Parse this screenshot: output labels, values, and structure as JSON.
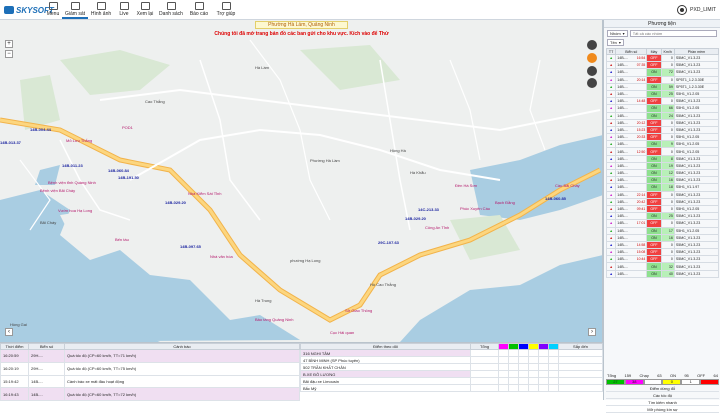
{
  "app": {
    "logo_text": "SKYSOFT",
    "user": "PXD_LIMIT"
  },
  "nav": [
    {
      "label": "Menu",
      "icon": "menu-icon"
    },
    {
      "label": "Giám sát",
      "icon": "monitor-icon"
    },
    {
      "label": "Hình ảnh",
      "icon": "image-icon"
    },
    {
      "label": "Live",
      "icon": "live-icon"
    },
    {
      "label": "Xem lại",
      "icon": "replay-icon"
    },
    {
      "label": "Danh sách",
      "icon": "list-icon"
    },
    {
      "label": "Báo cáo",
      "icon": "report-icon"
    },
    {
      "label": "Trợ giúp",
      "icon": "help-icon"
    }
  ],
  "map": {
    "location": "Phường Hà Lầm, Quảng Ninh",
    "notice": "Chúng tôi đã mở trang bản đồ các ban gửi cho khu vực. Kích vào để Thử",
    "labels": [
      "Hà Lầm",
      "Cao Thắng",
      "Phường Hà Lầm",
      "Hà Khẩu",
      "Bãi Cháy",
      "Hồng Gai",
      "phường Hạ Long",
      "Hồng Hà",
      "Hà Trung",
      "Hồ Cao Thắng"
    ],
    "plates": [
      "14B-004.44",
      "14B-013.37",
      "14B-011.23",
      "14B-060.84",
      "14B-191.50",
      "14B-029.20",
      "14B-097.65",
      "29C-107.63",
      "14C-213.33",
      "14B-029.20",
      "14B-060.85"
    ],
    "pois": [
      "POD1",
      "Mỏ Lưu Thắng",
      "Vườn hoa Hạ Long",
      "Bệnh viện Bãi Cháy",
      "Nhà Kiểm Sát Tỉnh",
      "Bệnh viện tỉnh Quảng Ninh",
      "Nhà văn hóa",
      "Công An Tỉnh",
      "Cầu Bãi Cháy",
      "Bảo tàng Quảng Ninh",
      "Bến tàu",
      "Phúc Xuyên Cầu",
      "Bạch Đằng",
      "Cục Hải quan",
      "Đền Hà Sơn",
      "Sở Giao Thông"
    ]
  },
  "panel": {
    "title": "Phương tiện",
    "group_select": "Nhóm",
    "search_placeholder": "Tất cả các nhóm",
    "sort_select": "Tên",
    "columns": [
      "TT",
      "Biển số",
      "Máy",
      "Km/h",
      "Phần mềm"
    ],
    "vehicles": [
      {
        "plate": "14B-...",
        "time": "16:54",
        "state": "OFF",
        "speed": "0",
        "sw": "S5MC_V1.3.23"
      },
      {
        "plate": "14B-...",
        "time": "07:35",
        "state": "OFF",
        "speed": "0",
        "sw": "S5MC_V1.3.23"
      },
      {
        "plate": "14B-...",
        "time": "",
        "state": "ON",
        "speed": "72",
        "sw": "S5MC_V1.3.23"
      },
      {
        "plate": "14B-...",
        "time": "20:14",
        "state": "OFF",
        "speed": "0",
        "sw": "SP5T1_1.2.3.30E"
      },
      {
        "plate": "14B-...",
        "time": "",
        "state": "ON",
        "speed": "59",
        "sw": "SP5T1_1.2.3.30E"
      },
      {
        "plate": "14B-...",
        "time": "",
        "state": "ON",
        "speed": "25",
        "sw": "S5H1_V1.2.05"
      },
      {
        "plate": "14B-...",
        "time": "14:48",
        "state": "OFF",
        "speed": "0",
        "sw": "S5MC_V1.3.23"
      },
      {
        "plate": "14B-...",
        "time": "",
        "state": "ON",
        "speed": "66",
        "sw": "S5H1_V1.2.05"
      },
      {
        "plate": "14B-...",
        "time": "",
        "state": "ON",
        "speed": "24",
        "sw": "S5MC_V1.3.23"
      },
      {
        "plate": "14B-...",
        "time": "20:12",
        "state": "OFF",
        "speed": "0",
        "sw": "S5MC_V1.3.23"
      },
      {
        "plate": "14B-...",
        "time": "15:23",
        "state": "OFF",
        "speed": "0",
        "sw": "S5MC_V1.3.23"
      },
      {
        "plate": "14B-...",
        "time": "20:33",
        "state": "OFF",
        "speed": "0",
        "sw": "S5H1_V1.2.05"
      },
      {
        "plate": "14B-...",
        "time": "",
        "state": "ON",
        "speed": "9",
        "sw": "S5H1_V1.2.05"
      },
      {
        "plate": "14B-...",
        "time": "12:50",
        "state": "OFF",
        "speed": "0",
        "sw": "S5H1_V1.2.05"
      },
      {
        "plate": "14B-...",
        "time": "",
        "state": "ON",
        "speed": "8",
        "sw": "S5MC_V1.3.23"
      },
      {
        "plate": "14B-...",
        "time": "",
        "state": "ON",
        "speed": "19",
        "sw": "S5MC_V1.3.23"
      },
      {
        "plate": "14B-...",
        "time": "",
        "state": "ON",
        "speed": "12",
        "sw": "S5MC_V1.3.23"
      },
      {
        "plate": "14B-...",
        "time": "",
        "state": "ON",
        "speed": "16",
        "sw": "S5MC_V1.3.23"
      },
      {
        "plate": "14B-...",
        "time": "",
        "state": "ON",
        "speed": "18",
        "sw": "S5H1_V1.1.97"
      },
      {
        "plate": "14B-...",
        "time": "22:14",
        "state": "OFF",
        "speed": "0",
        "sw": "S5MC_V1.3.23"
      },
      {
        "plate": "14B-...",
        "time": "20:42",
        "state": "OFF",
        "speed": "0",
        "sw": "S5MC_V1.3.23"
      },
      {
        "plate": "14B-...",
        "time": "09:41",
        "state": "OFF",
        "speed": "0",
        "sw": "S5H1_V1.2.05"
      },
      {
        "plate": "14B-...",
        "time": "",
        "state": "ON",
        "speed": "25",
        "sw": "S5MC_V1.3.23"
      },
      {
        "plate": "14B-...",
        "time": "17:01",
        "state": "OFF",
        "speed": "0",
        "sw": "S5MC_V1.3.23"
      },
      {
        "plate": "14B-...",
        "time": "",
        "state": "ON",
        "speed": "17",
        "sw": "S5H1_V1.2.05"
      },
      {
        "plate": "14B-...",
        "time": "",
        "state": "ON",
        "speed": "16",
        "sw": "S5MC_V1.3.23"
      },
      {
        "plate": "14B-...",
        "time": "14:58",
        "state": "OFF",
        "speed": "0",
        "sw": "S5MC_V1.3.23"
      },
      {
        "plate": "14B-...",
        "time": "15:08",
        "state": "OFF",
        "speed": "0",
        "sw": "S5MC_V1.3.23"
      },
      {
        "plate": "14B-...",
        "time": "10:44",
        "state": "OFF",
        "speed": "0",
        "sw": "S5MC_V1.3.23"
      },
      {
        "plate": "14B-...",
        "time": "",
        "state": "ON",
        "speed": "32",
        "sw": "S5MC_V1.3.23"
      },
      {
        "plate": "14B-...",
        "time": "",
        "state": "ON",
        "speed": "40",
        "sw": "S5MC_V1.3.23"
      }
    ],
    "summary": {
      "total_label": "Tổng",
      "total": "159",
      "run_label": "Chạy",
      "run": "63",
      "on_label": "ON",
      "on": "95",
      "off_label": "OFF",
      "off": "64"
    },
    "bar_values": [
      "27",
      "38",
      "",
      "0",
      "1",
      ""
    ],
    "links": [
      "Điểm dừng đỗ",
      "Các tốc độ",
      "Tìm kiếm nhanh",
      "Mở phòng kín sự"
    ]
  },
  "alerts": {
    "columns": [
      "Thời điểm",
      "Biển số",
      "Cảnh báo"
    ],
    "rows": [
      {
        "time": "16:20:59",
        "plate": "29H-...",
        "msg": "Quá tốc độ (CP=60 km/h, TT=71 km/h)",
        "hl": true
      },
      {
        "time": "16:20:19",
        "plate": "29H-...",
        "msg": "Quá tốc độ (CP=60 km/h, TT=75 km/h)",
        "hl": false
      },
      {
        "time": "15:19:42",
        "plate": "14B-...",
        "msg": "Cảnh báo xe mất đầu hoạt động",
        "hl": false
      },
      {
        "time": "16:19:43",
        "plate": "14B-...",
        "msg": "Quá tốc độ (CP=60 km/h, TT=72 km/h)",
        "hl": true
      }
    ]
  },
  "points": {
    "columns": [
      "Điểm theo dõi",
      "Tổng",
      "",
      "",
      "",
      "",
      "",
      "",
      "Sắp đến"
    ],
    "colors": [
      "#ff00ff",
      "#00c000",
      "#0000ff",
      "#ffff00",
      "#8000ff",
      "#00d0ff",
      "#ff0000"
    ],
    "rows": [
      {
        "name": "316 NGHI TÂM",
        "hl": true
      },
      {
        "name": "47 BÌNH MINH (SP Phúc tuyên)",
        "hl": false
      },
      {
        "name": "502 TRẦN KHẤT CHÂN",
        "hl": false
      },
      {
        "name": "B.XE ĐÔ LƯƠNG",
        "hl": true
      },
      {
        "name": "Bãi đậu xe Limousin",
        "hl": false
      },
      {
        "name": "Bắc Mỹ",
        "hl": false
      }
    ]
  }
}
